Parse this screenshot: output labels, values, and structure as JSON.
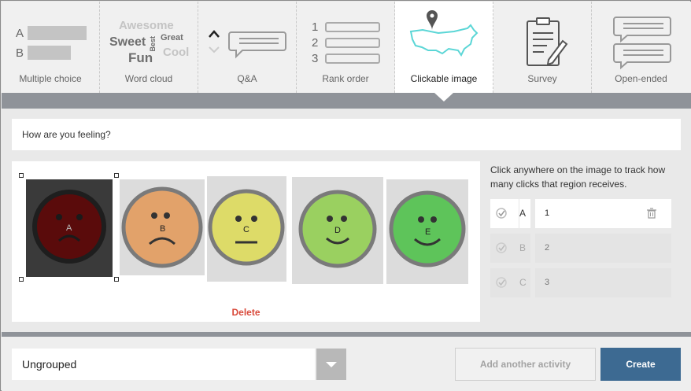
{
  "activity_types": [
    {
      "label": "Multiple choice",
      "icon": "multiple-choice-icon",
      "letters": [
        "A",
        "B"
      ]
    },
    {
      "label": "Word cloud",
      "icon": "word-cloud-icon",
      "words": [
        "Awesome",
        "Sweet",
        "Best",
        "Great",
        "Fun",
        "Cool"
      ]
    },
    {
      "label": "Q&A",
      "icon": "qa-icon"
    },
    {
      "label": "Rank order",
      "icon": "rank-order-icon",
      "numbers": [
        "1",
        "2",
        "3"
      ]
    },
    {
      "label": "Clickable image",
      "icon": "clickable-image-icon",
      "active": true
    },
    {
      "label": "Survey",
      "icon": "survey-icon"
    },
    {
      "label": "Open-ended",
      "icon": "open-ended-icon"
    }
  ],
  "question": {
    "text": "How are you feeling?"
  },
  "image": {
    "faces": [
      {
        "letter": "A",
        "color": "#5a0b0b",
        "mood": "sad"
      },
      {
        "letter": "B",
        "color": "#e2a26a",
        "mood": "sad"
      },
      {
        "letter": "C",
        "color": "#dddb68",
        "mood": "neutral"
      },
      {
        "letter": "D",
        "color": "#9ad060",
        "mood": "happy"
      },
      {
        "letter": "E",
        "color": "#5ec45a",
        "mood": "happy"
      }
    ],
    "delete_label": "Delete"
  },
  "hint": "Click anywhere on the image to track how many clicks that region receives.",
  "regions": [
    {
      "letter": "A",
      "value": "1",
      "active": true
    },
    {
      "letter": "B",
      "value": "2",
      "active": false
    },
    {
      "letter": "C",
      "value": "3",
      "active": false
    }
  ],
  "bottom": {
    "group": "Ungrouped",
    "add_another": "Add another activity",
    "create": "Create"
  },
  "colors": {
    "accent": "#3d6a92",
    "delete": "#d94a3b",
    "map": "#5bd6d6"
  }
}
